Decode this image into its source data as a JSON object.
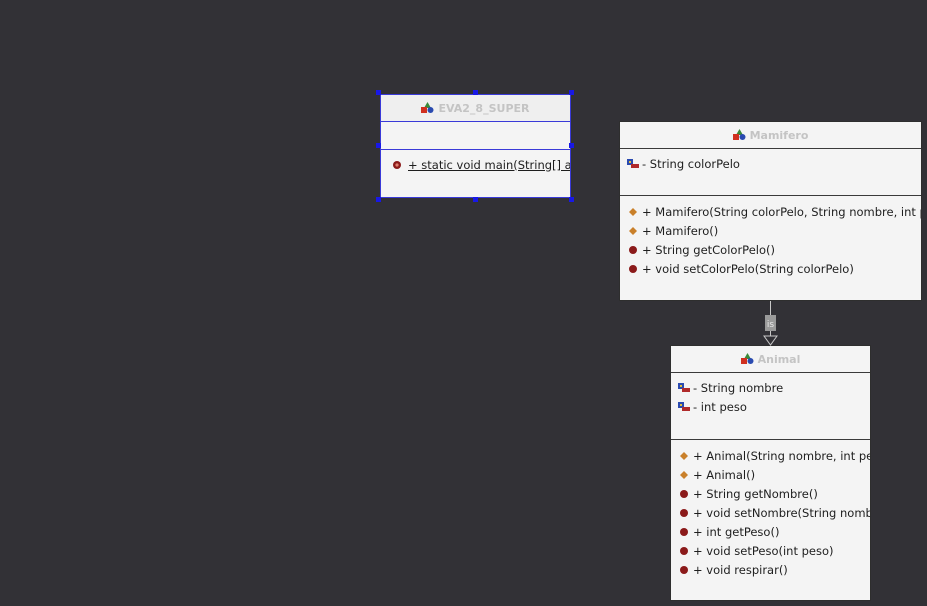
{
  "colors": {
    "canvas": "#323136",
    "box_fill": "#f4f4f4",
    "box_border": "#2e2e2e",
    "selection": "#1818e6",
    "title_text": "#c4c4c4",
    "constructor_icon": "#c9802a",
    "method_icon": "#8b1a1a"
  },
  "classes": {
    "main_class": {
      "title": "EVA2_8_SUPER",
      "icon": "class-icon",
      "attributes": [],
      "methods": [
        {
          "text": "+ static void main(String[] args",
          "icon": "static-method-icon",
          "underline": true
        }
      ]
    },
    "mamifero": {
      "title": "Mamifero",
      "icon": "class-icon",
      "attributes": [
        {
          "text": "- String colorPelo",
          "icon": "private-field-icon"
        }
      ],
      "methods": [
        {
          "text": "+ Mamifero(String colorPelo, String nombre, int pes",
          "icon": "constructor-icon"
        },
        {
          "text": "+ Mamifero()",
          "icon": "constructor-icon"
        },
        {
          "text": "+ String getColorPelo()",
          "icon": "method-icon"
        },
        {
          "text": "+ void setColorPelo(String colorPelo)",
          "icon": "method-icon"
        }
      ]
    },
    "animal": {
      "title": "Animal",
      "icon": "class-icon",
      "attributes": [
        {
          "text": "- String nombre",
          "icon": "private-field-icon"
        },
        {
          "text": "- int peso",
          "icon": "private-field-icon"
        }
      ],
      "methods": [
        {
          "text": "+ Animal(String nombre, int pes",
          "icon": "constructor-icon"
        },
        {
          "text": "+ Animal()",
          "icon": "constructor-icon"
        },
        {
          "text": "+ String getNombre()",
          "icon": "method-icon"
        },
        {
          "text": "+ void setNombre(String nombre",
          "icon": "method-icon"
        },
        {
          "text": "+ int getPeso()",
          "icon": "method-icon"
        },
        {
          "text": "+ void setPeso(int peso)",
          "icon": "method-icon"
        },
        {
          "text": "+ void respirar()",
          "icon": "method-icon"
        }
      ]
    }
  },
  "relations": [
    {
      "type": "generalization",
      "from": "mamifero",
      "to": "animal",
      "label": "is"
    }
  ]
}
